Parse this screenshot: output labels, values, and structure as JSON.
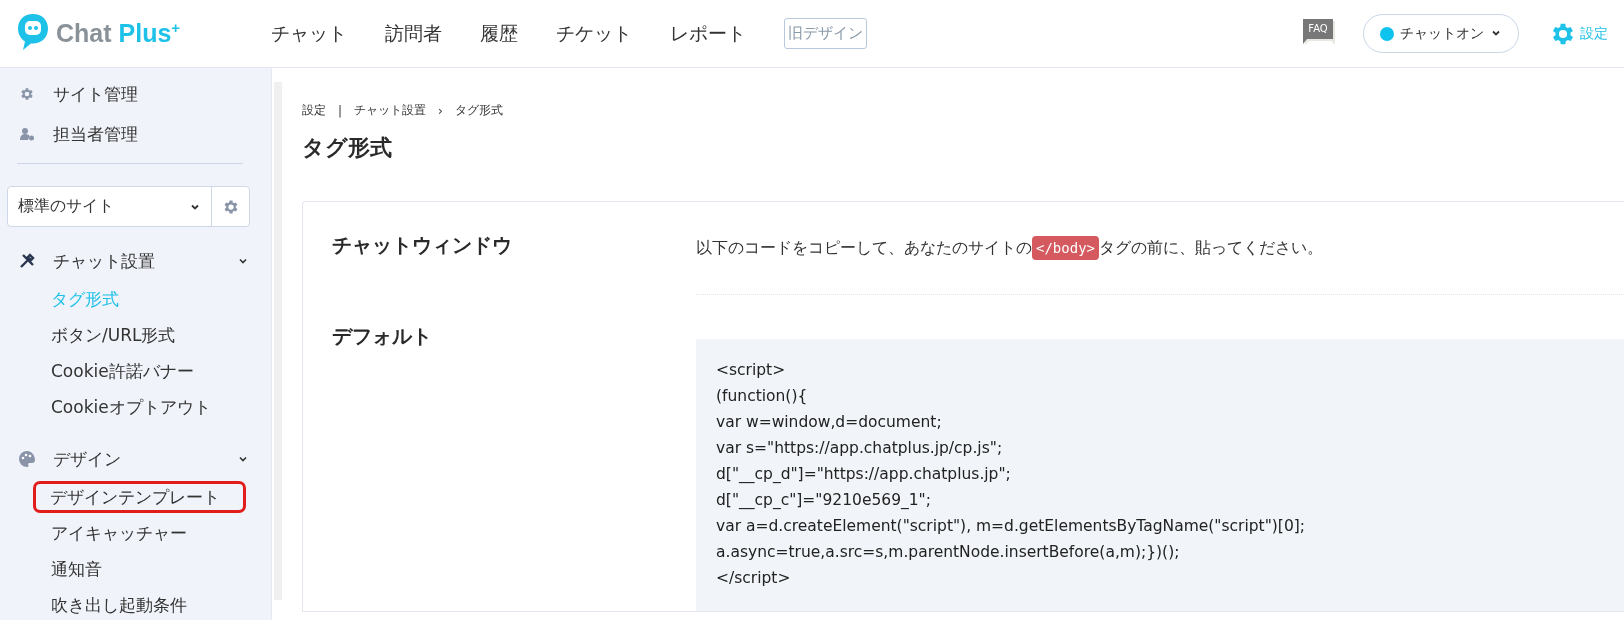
{
  "header": {
    "logo": {
      "name": "Chat",
      "accent": "Plus$^{+}$"
    },
    "nav": [
      {
        "label": "チャット"
      },
      {
        "label": "訪問者"
      },
      {
        "label": "履歴"
      },
      {
        "label": "チケット"
      },
      {
        "label": "レポート"
      }
    ],
    "old_design_button": "旧デザイン",
    "faq": "FAQ",
    "status": {
      "label": "チャットオン",
      "online": true
    },
    "settings": "設定"
  },
  "sidebar": {
    "admin_items": [
      {
        "label": "サイト管理"
      },
      {
        "label": "担当者管理"
      }
    ],
    "site_select": {
      "value": "標準のサイト"
    },
    "sections": [
      {
        "label": "チャット設置",
        "expanded": true,
        "children": [
          {
            "label": "タグ形式",
            "selected": true,
            "highlighted": false
          },
          {
            "label": "ボタン/URL形式",
            "selected": false,
            "highlighted": false
          },
          {
            "label": "Cookie許諾バナー",
            "selected": false,
            "highlighted": false
          },
          {
            "label": "Cookieオプトアウト",
            "selected": false,
            "highlighted": false
          }
        ]
      },
      {
        "label": "デザイン",
        "expanded": true,
        "children": [
          {
            "label": "デザインテンプレート",
            "selected": false,
            "highlighted": true
          },
          {
            "label": "アイキャッチャー",
            "selected": false,
            "highlighted": false
          },
          {
            "label": "通知音",
            "selected": false,
            "highlighted": false
          },
          {
            "label": "吹き出し起動条件",
            "selected": false,
            "highlighted": false
          }
        ]
      }
    ]
  },
  "breadcrumb": [
    {
      "label": "設定",
      "separator": "|"
    },
    {
      "label": "チャット設置",
      "separator": "›"
    },
    {
      "label": "タグ形式"
    }
  ],
  "title": "タグ形式",
  "card": {
    "section_title": "チャットウィンドウ",
    "instruction": {
      "before": "以下のコードをコピーして、あなたのサイトの",
      "code": "</body>",
      "after": "タグの前に、貼ってください。"
    },
    "code_label": "デフォルト",
    "code_lines": [
      "<script>",
      "(function(){",
      "var w=window,d=document;",
      "var s=\"https://app.chatplus.jp/cp.js\";",
      "d[\"__cp_d\"]=\"https://app.chatplus.jp\";",
      "d[\"__cp_c\"]=\"9210e569_1\";",
      "var a=d.createElement(\"script\"), m=d.getElementsByTagName(\"script\")[0];",
      "a.async=true,a.src=s,m.parentNode.insertBefore(a,m);})();",
      "</script>"
    ]
  }
}
